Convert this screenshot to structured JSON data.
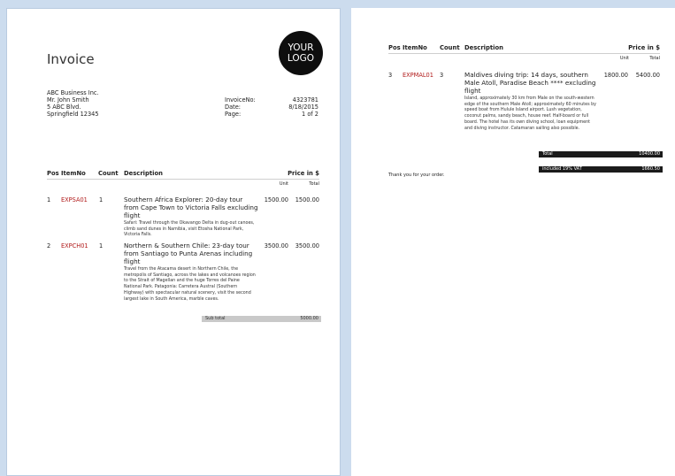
{
  "invoice": {
    "title": "Invoice",
    "logo_line1": "YOUR",
    "logo_line2": "LOGO",
    "sender": [
      "ABC Business Inc.",
      "Mr. John Smith",
      "5 ABC Blvd.",
      "Springfield 12345"
    ],
    "meta_labels": [
      "InvoiceNo:",
      "Date:",
      "Page:"
    ],
    "meta_values": [
      "4323781",
      "8/18/2015",
      "1 of 2"
    ]
  },
  "columns": {
    "pos": "Pos",
    "itemno": "ItemNo",
    "count": "Count",
    "description": "Description",
    "price": "Price in $",
    "unit": "Unit",
    "total": "Total"
  },
  "items": [
    {
      "pos": "1",
      "itemno": "EXPSA01",
      "count": "1",
      "title": "Southern Africa Explorer: 20-day tour from Cape Town to Victoria Falls excluding flight",
      "body": "Safari: Travel through the Okavango Delta in dug-out canoes, climb sand dunes in Namibia, visit Etosha National Park, Victoria Falls.",
      "unit": "1500.00",
      "total": "1500.00"
    },
    {
      "pos": "2",
      "itemno": "EXPCH01",
      "count": "1",
      "title": "Northern & Southern Chile: 23-day tour from Santiago to Punta Arenas including flight",
      "body": "Travel from the Atacama desert in Northern Chile, the metropolis of Santiago, across the lakes and volcanoes region to the Strait of Magellan and the huge Torres del Paine National Park. Patagonia: Carretera Austral (Southern Highway) with spectacular natural scenery, visit the second largest lake in South America, marble caves.",
      "unit": "3500.00",
      "total": "3500.00"
    },
    {
      "pos": "3",
      "itemno": "EXPMAL01",
      "count": "3",
      "title": "Maldives diving trip: 14 days, southern Male Atoll, Paradise Beach **** excluding flight",
      "body": "Island, approximately 30 km from Male on the south-western edge of the southern Male Atoll; approximately 60 minutes by speed boat from Hulule Island airport. Lush vegetation, coconut palms, sandy beach, house reef. Half-board or full board. The hotel has its own diving school, loan equipment and diving instructor. Catamaran sailing also possible.",
      "unit": "1800.00",
      "total": "5400.00"
    }
  ],
  "subtotal": {
    "label": "Sub total",
    "value": "5000.00"
  },
  "total": {
    "label": "Total",
    "value": "10400.00"
  },
  "vat": {
    "label": "included 19% VAT",
    "value": "1660.50"
  },
  "thanks": "Thank you for your order."
}
